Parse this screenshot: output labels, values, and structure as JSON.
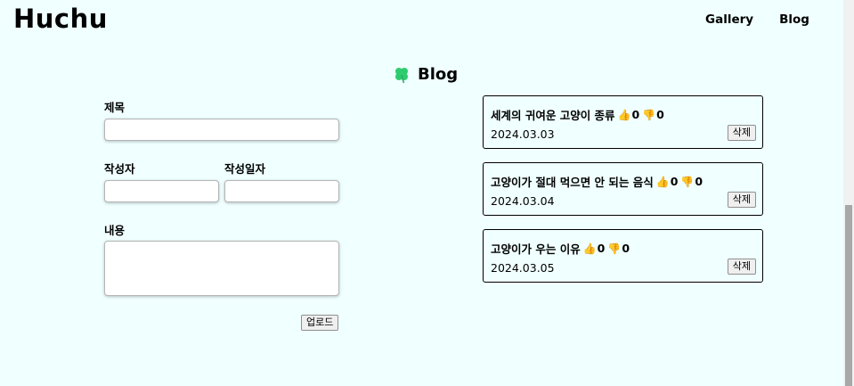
{
  "header": {
    "logo": "Huchu",
    "nav": [
      "Gallery",
      "Blog"
    ]
  },
  "page": {
    "title": "Blog",
    "title_icon": "four-leaf-clover-icon",
    "accent_color": "#2ecc71"
  },
  "form": {
    "title_label": "제목",
    "title_value": "",
    "author_label": "작성자",
    "author_value": "",
    "date_label": "작성일자",
    "date_value": "",
    "content_label": "내용",
    "content_value": "",
    "upload_label": "업로드"
  },
  "posts": [
    {
      "title": "세계의 귀여운 고양이 종류",
      "likes": "0",
      "dislikes": "0",
      "date": "2024.03.03",
      "delete_label": "삭제"
    },
    {
      "title": "고양이가 절대 먹으면 안 되는 음식",
      "likes": "0",
      "dislikes": "0",
      "date": "2024.03.04",
      "delete_label": "삭제"
    },
    {
      "title": "고양이가 우는 이유",
      "likes": "0",
      "dislikes": "0",
      "date": "2024.03.05",
      "delete_label": "삭제"
    }
  ],
  "icons": {
    "like": "thumbs-up-icon",
    "dislike": "thumbs-down-icon"
  },
  "glyphs": {
    "like": "👍",
    "dislike": "👎"
  }
}
